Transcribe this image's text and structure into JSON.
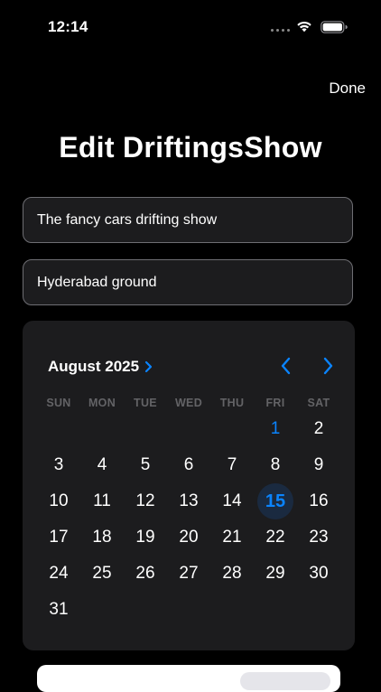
{
  "status_bar": {
    "time": "12:14",
    "icons": [
      "cellular-dots-icon",
      "wifi-icon",
      "battery-icon"
    ]
  },
  "nav": {
    "done_label": "Done"
  },
  "page": {
    "title": "Edit DriftingsShow"
  },
  "form": {
    "name_value": "The fancy cars drifting show",
    "location_value": "Hyderabad ground"
  },
  "calendar": {
    "month_label": "August 2025",
    "weekdays": [
      "SUN",
      "MON",
      "TUE",
      "WED",
      "THU",
      "FRI",
      "SAT"
    ],
    "first_weekday_index": 5,
    "days_in_month": 31,
    "today": 1,
    "selected_day": 15,
    "days": [
      "1",
      "2",
      "3",
      "4",
      "5",
      "6",
      "7",
      "8",
      "9",
      "10",
      "11",
      "12",
      "13",
      "14",
      "15",
      "16",
      "17",
      "18",
      "19",
      "20",
      "21",
      "22",
      "23",
      "24",
      "25",
      "26",
      "27",
      "28",
      "29",
      "30",
      "31"
    ]
  },
  "colors": {
    "background": "#000000",
    "card": "#1c1c1e",
    "accent": "#0a84ff",
    "field_border": "#6e6e73",
    "weekday_text": "#636366"
  }
}
